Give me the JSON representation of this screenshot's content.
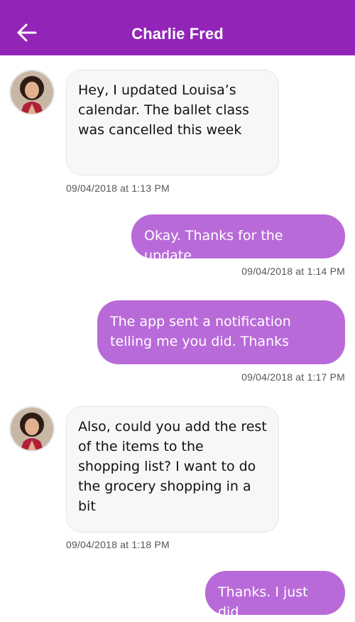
{
  "header": {
    "title": "Charlie Fred",
    "back_icon": "arrow-left-icon"
  },
  "colors": {
    "header_bg": "#9225b8",
    "outgoing_bubble": "#b96ad9",
    "incoming_bubble": "#f6f7f7"
  },
  "messages": [
    {
      "direction": "incoming",
      "text": "Hey, I updated Louisa’s calendar. The ballet class was cancelled this week",
      "timestamp": "09/04/2018 at 1:13 PM"
    },
    {
      "direction": "outgoing",
      "text": "Okay. Thanks for the update",
      "timestamp": "09/04/2018 at 1:14 PM"
    },
    {
      "direction": "outgoing",
      "text": "The app sent a notification telling me you did. Thanks",
      "timestamp": "09/04/2018 at 1:17 PM"
    },
    {
      "direction": "incoming",
      "text": "Also, could you add the rest of the items to the shopping list? I want to do the grocery shopping in a bit",
      "timestamp": "09/04/2018 at 1:18 PM"
    },
    {
      "direction": "outgoing",
      "text": "Thanks. I just did",
      "timestamp": ""
    }
  ]
}
